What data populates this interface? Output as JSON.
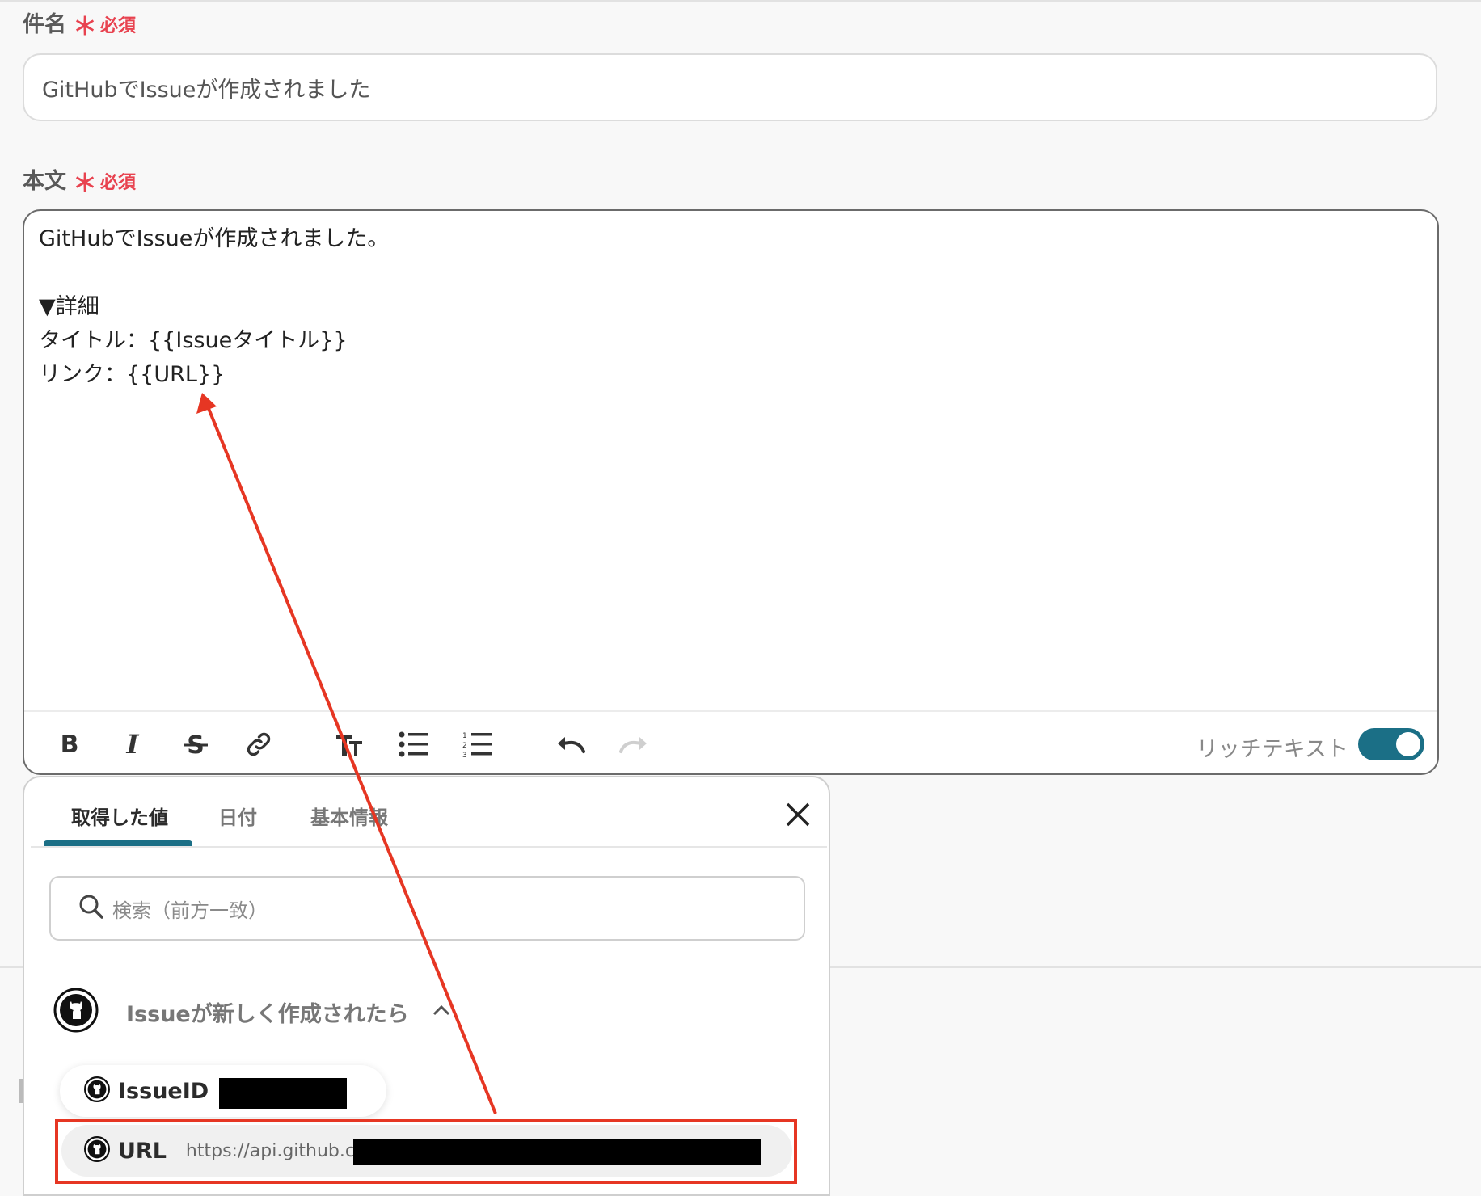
{
  "subject": {
    "label": "件名",
    "required_mark": "＊",
    "required_text": "必須",
    "value": "GitHubでIssueが作成されました"
  },
  "body": {
    "label": "本文",
    "required_mark": "＊",
    "required_text": "必須",
    "lines": [
      "GitHubでIssueが作成されました。",
      "",
      "▼詳細",
      "タイトル：{{Issueタイトル}}",
      "リンク：{{URL}}"
    ],
    "toolbar": {
      "icons": [
        "bold-icon",
        "italic-icon",
        "strikethrough-icon",
        "link-icon",
        "text-format-icon",
        "bullet-list-icon",
        "numbered-list-icon",
        "undo-icon",
        "redo-icon"
      ],
      "rich_text_label": "リッチテキスト",
      "rich_text_enabled": true
    }
  },
  "panel": {
    "tabs": [
      {
        "label": "取得した値",
        "active": true
      },
      {
        "label": "日付",
        "active": false
      },
      {
        "label": "基本情報",
        "active": false
      }
    ],
    "search_placeholder": "検索（前方一致）",
    "group": {
      "title": "Issueが新しく作成されたら",
      "expanded": true
    },
    "items": [
      {
        "label": "IssueID",
        "value": ""
      },
      {
        "label": "URL",
        "value": "https://api.github.c"
      }
    ]
  },
  "colors": {
    "accent": "#1b6f86",
    "required": "#e8424f",
    "annotation": "#e63623"
  }
}
